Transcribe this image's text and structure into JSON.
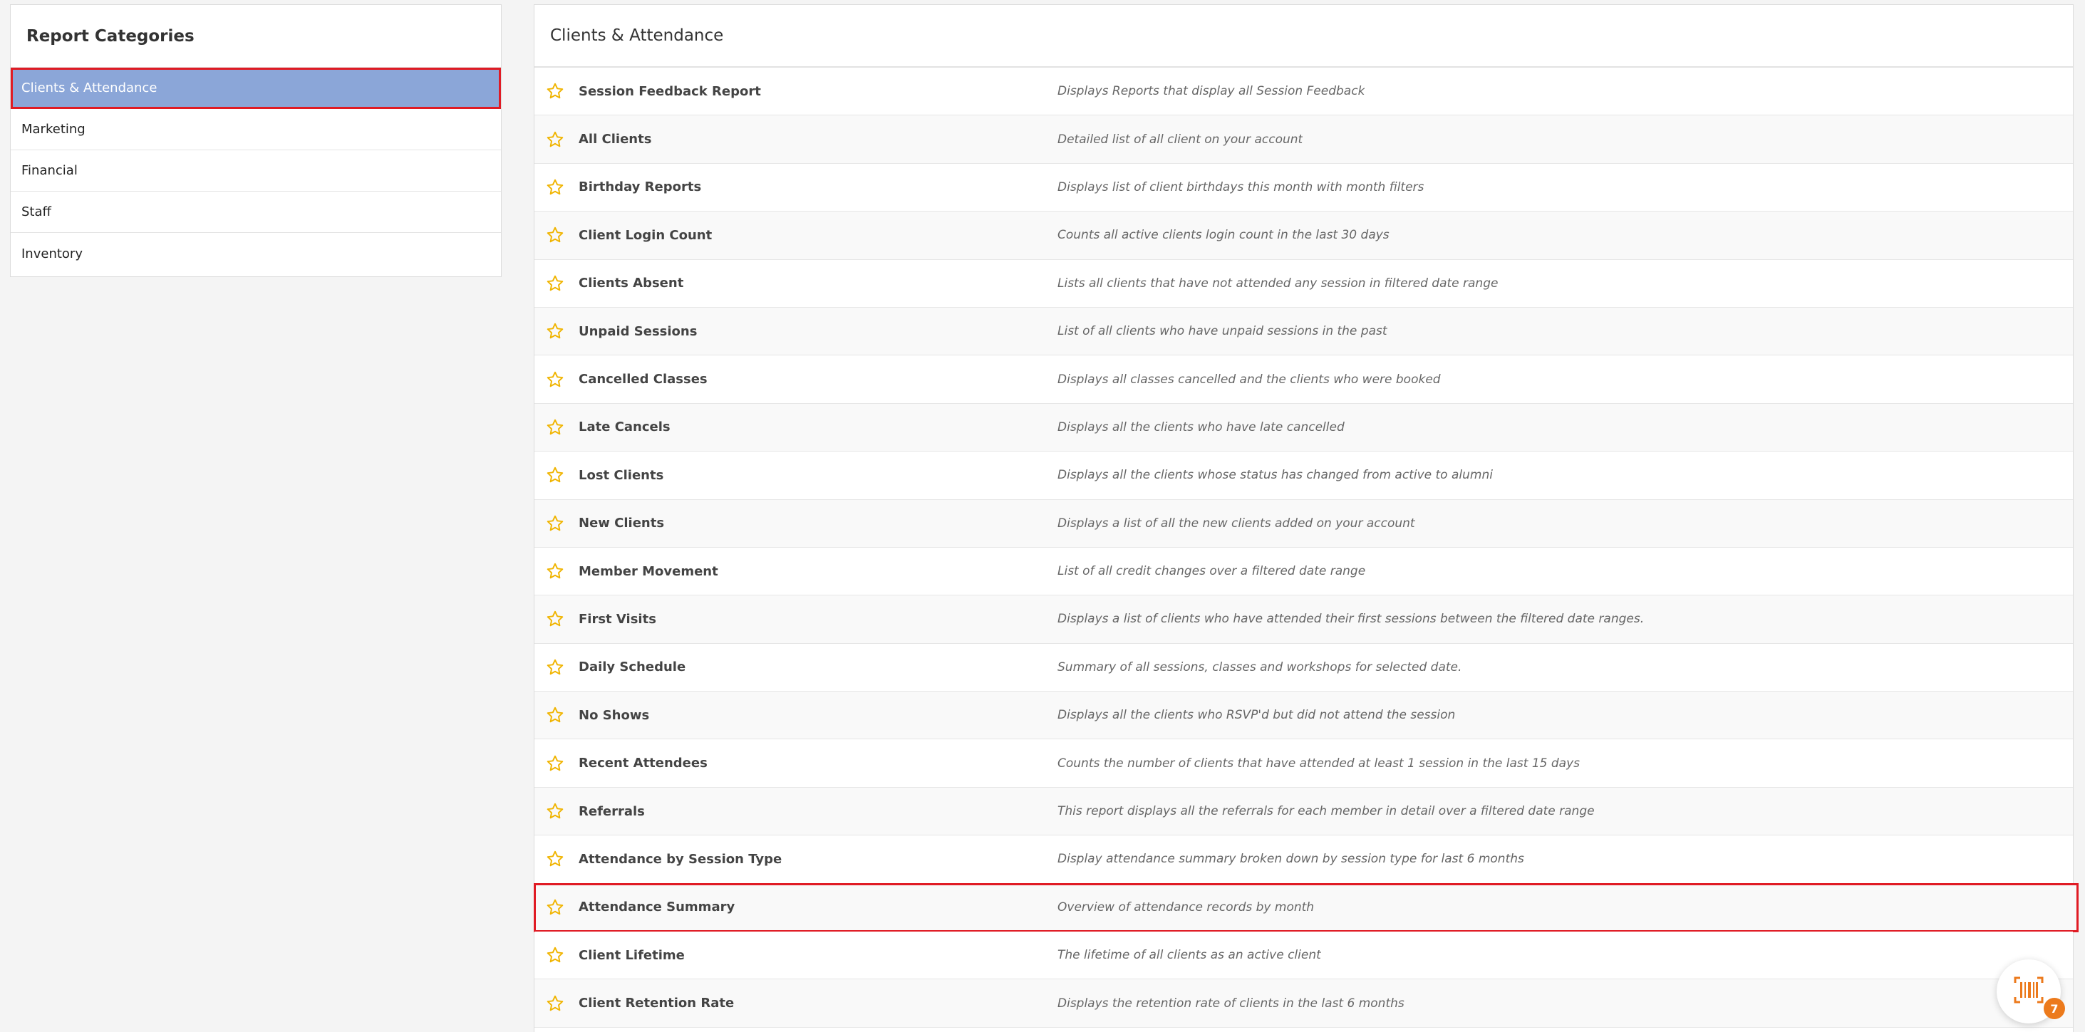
{
  "colors": {
    "accent_selected": "#8ba6d8",
    "highlight_border": "#e01b24",
    "star": "#f0b400",
    "widget_icon": "#ec7a1c"
  },
  "sidebar": {
    "title": "Report Categories",
    "items": [
      {
        "label": "Clients & Attendance",
        "active": true
      },
      {
        "label": "Marketing",
        "active": false
      },
      {
        "label": "Financial",
        "active": false
      },
      {
        "label": "Staff",
        "active": false
      },
      {
        "label": "Inventory",
        "active": false
      }
    ]
  },
  "main": {
    "title": "Clients & Attendance",
    "reports": [
      {
        "name": "Session Feedback Report",
        "description": "Displays Reports that display all Session Feedback"
      },
      {
        "name": "All Clients",
        "description": "Detailed list of all client on your account"
      },
      {
        "name": "Birthday Reports",
        "description": "Displays list of client birthdays this month with month filters"
      },
      {
        "name": "Client Login Count",
        "description": "Counts all active clients login count in the last 30 days"
      },
      {
        "name": "Clients Absent",
        "description": "Lists all clients that have not attended any session in filtered date range"
      },
      {
        "name": "Unpaid Sessions",
        "description": "List of all clients who have unpaid sessions in the past"
      },
      {
        "name": "Cancelled Classes",
        "description": "Displays all classes cancelled and the clients who were booked"
      },
      {
        "name": "Late Cancels",
        "description": "Displays all the clients who have late cancelled"
      },
      {
        "name": "Lost Clients",
        "description": "Displays all the clients whose status has changed from active to alumni"
      },
      {
        "name": "New Clients",
        "description": "Displays a list of all the new clients added on your account"
      },
      {
        "name": "Member Movement",
        "description": "List of all credit changes over a filtered date range"
      },
      {
        "name": "First Visits",
        "description": "Displays a list of clients who have attended their first sessions between the filtered date ranges."
      },
      {
        "name": "Daily Schedule",
        "description": "Summary of all sessions, classes and workshops for selected date."
      },
      {
        "name": "No Shows",
        "description": "Displays all the clients who RSVP'd but did not attend the session"
      },
      {
        "name": "Recent Attendees",
        "description": "Counts the number of clients that have attended at least 1 session in the last 15 days"
      },
      {
        "name": "Referrals",
        "description": "This report displays all the referrals for each member in detail over a filtered date range"
      },
      {
        "name": "Attendance by Session Type",
        "description": "Display attendance summary broken down by session type for last 6 months"
      },
      {
        "name": "Attendance Summary",
        "description": "Overview of attendance records by month",
        "highlighted": true
      },
      {
        "name": "Client Lifetime",
        "description": "The lifetime of all clients as an active client"
      },
      {
        "name": "Client Retention Rate",
        "description": "Displays the retention rate of clients in the last 6 months"
      }
    ]
  },
  "widget": {
    "icon": "barcode-icon",
    "badge_count": "7"
  }
}
